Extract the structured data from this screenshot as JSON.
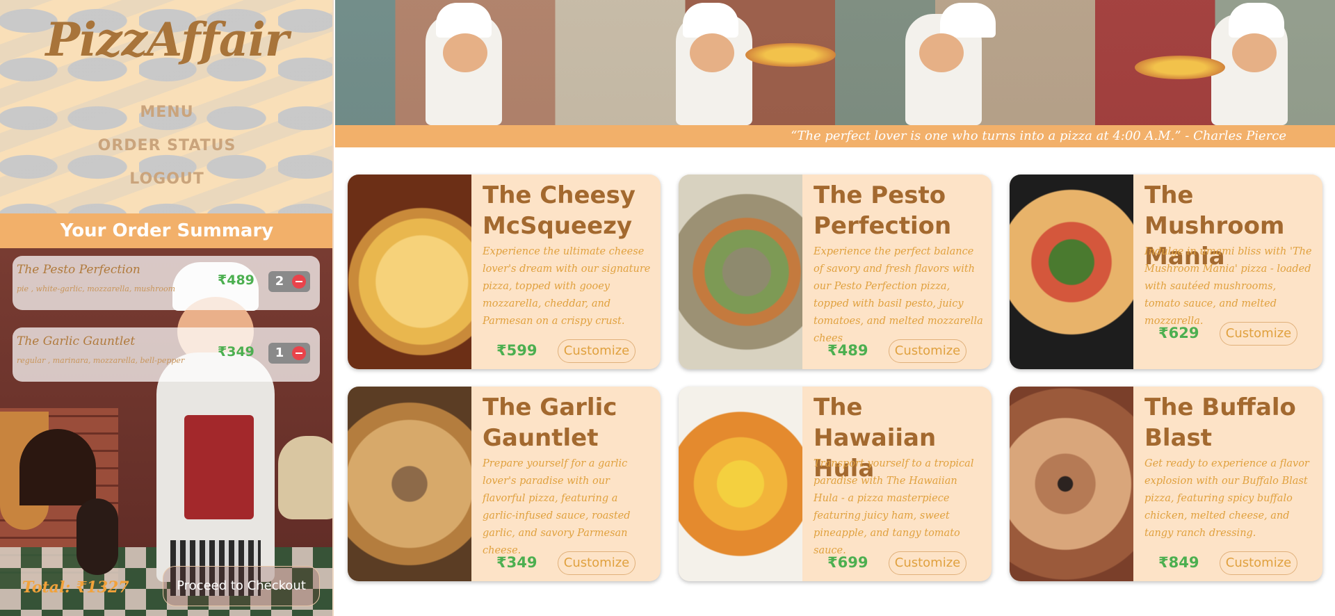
{
  "brand": {
    "logo": "PizzAffair"
  },
  "nav": {
    "items": [
      "MENU",
      "ORDER STATUS",
      "LOGOUT"
    ]
  },
  "order_summary": {
    "title": "Your Order Summary",
    "items": [
      {
        "name": "The Pesto Perfection",
        "meta": "pie , white-garlic, mozzarella, mushroom",
        "price": "₹489",
        "qty": "2"
      },
      {
        "name": "The Garlic Gauntlet",
        "meta": "regular , marinara, mozzarella, bell-pepper",
        "price": "₹349",
        "qty": "1"
      }
    ],
    "total": "Total: ₹1327",
    "checkout_label": "Proceed to Checkout"
  },
  "banner": {
    "quote": "“The perfect lover is one who turns into a pizza at 4:00 A.M.” - Charles Pierce"
  },
  "menu": {
    "customize_label": "Customize",
    "pizzas": [
      {
        "title": "The Cheesy McSqueezy",
        "desc": "Experience the ultimate cheese lover's dream with our signature pizza, topped with gooey mozzarella, cheddar, and Parmesan on a crispy crust.",
        "price": "₹599"
      },
      {
        "title": "The Pesto Perfection",
        "desc": "Experience the perfect balance of savory and fresh flavors with our Pesto Perfection pizza, topped with basil pesto, juicy tomatoes, and melted mozzarella chees",
        "price": "₹489"
      },
      {
        "title": "The Mushroom Mania",
        "desc": "Indulge in umami bliss with 'The Mushroom Mania' pizza - loaded with sautéed mushrooms, tomato sauce, and melted mozzarella.",
        "price": "₹629"
      },
      {
        "title": "The Garlic Gauntlet",
        "desc": "Prepare yourself for a garlic lover's paradise with our flavorful pizza, featuring a garlic-infused sauce, roasted garlic, and savory Parmesan cheese.",
        "price": "₹349"
      },
      {
        "title": "The Hawaiian Hula",
        "desc": "Transport yourself to a tropical paradise with The Hawaiian Hula - a pizza masterpiece featuring juicy ham, sweet pineapple, and tangy tomato sauce.",
        "price": "₹699"
      },
      {
        "title": "The Buffalo Blast",
        "desc": "Get ready to experience a flavor explosion with our Buffalo Blast pizza, featuring spicy buffalo chicken, melted cheese, and tangy ranch dressing.",
        "price": "₹849"
      }
    ]
  },
  "colors": {
    "accent": "#f2b06a",
    "brand_brown": "#a3692f",
    "price_green": "#4caf50",
    "card_bg": "#fde3c7",
    "remove_red": "#e9434b"
  }
}
